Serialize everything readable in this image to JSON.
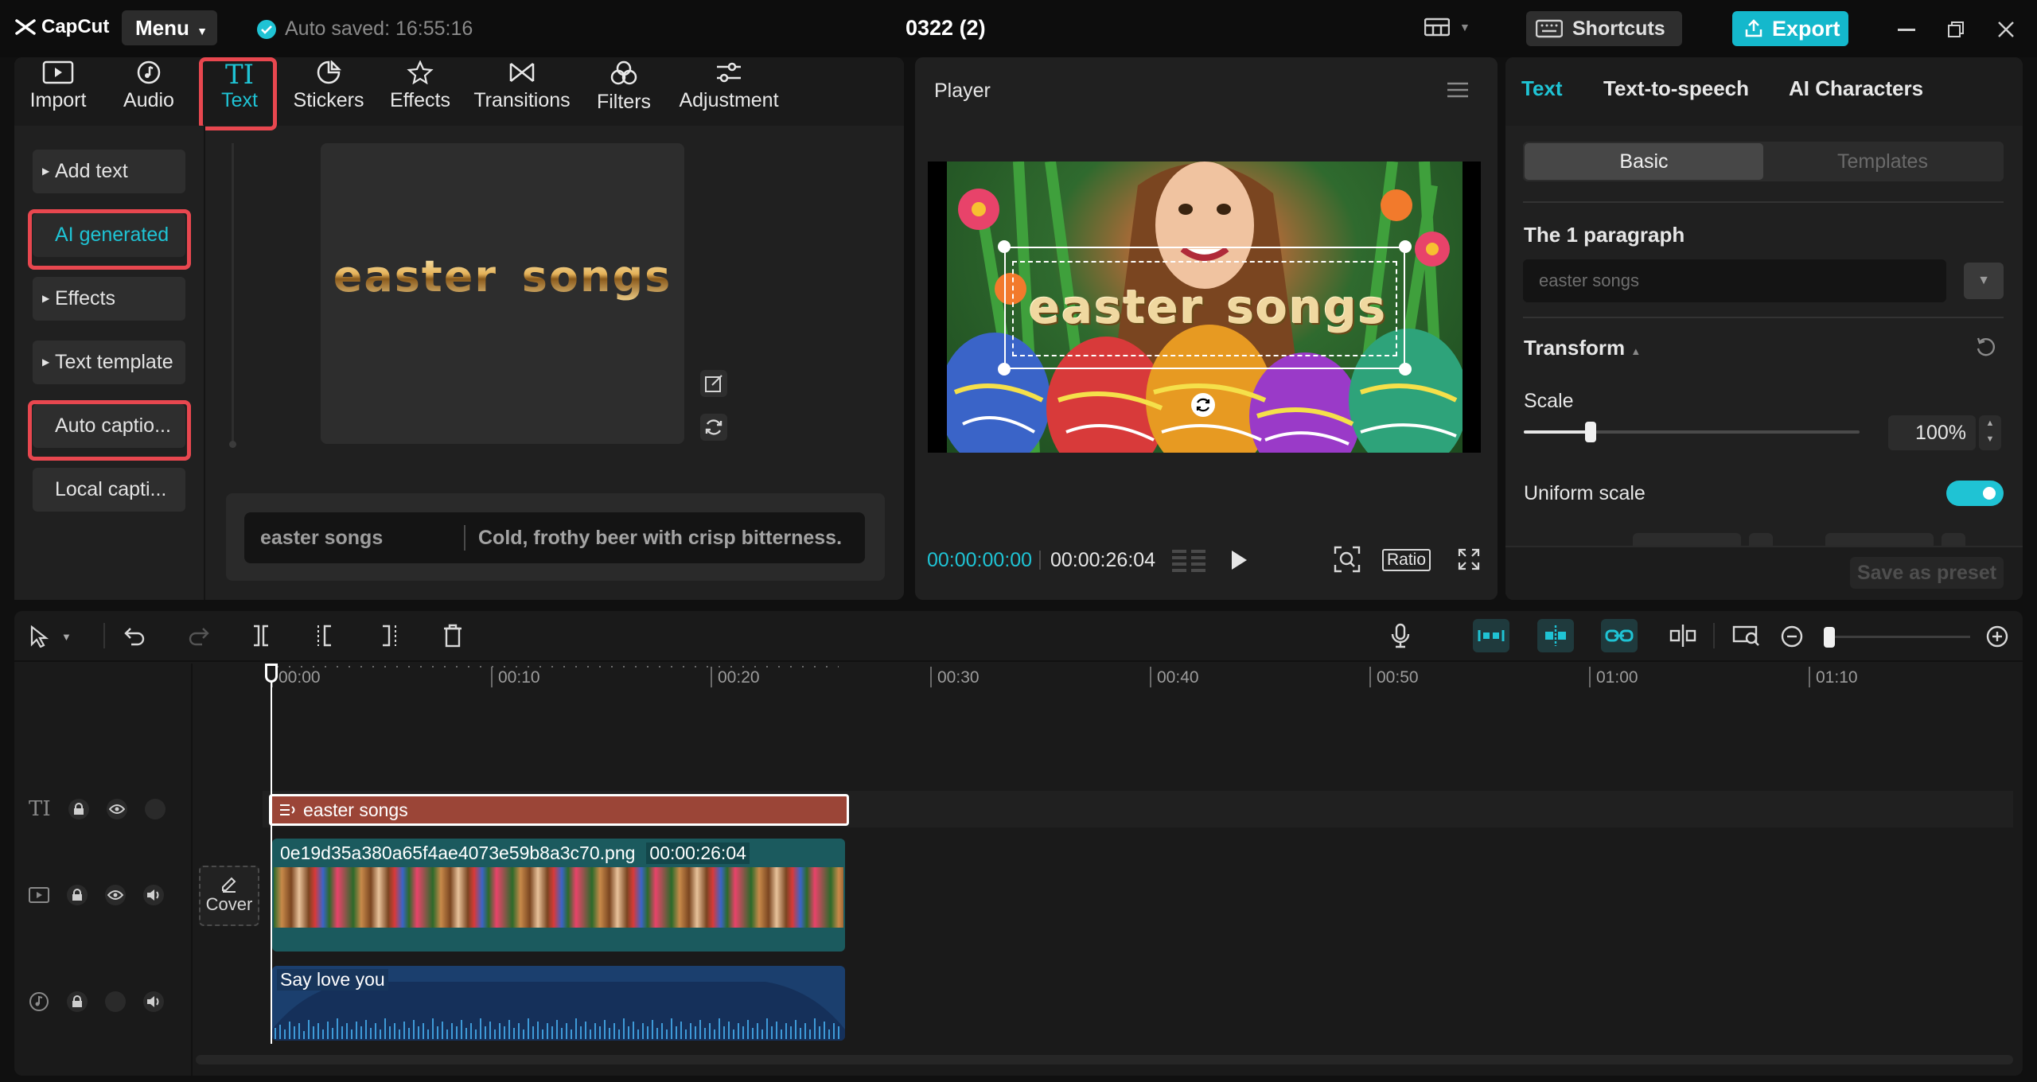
{
  "app": {
    "name": "CapCut",
    "menu_label": "Menu",
    "autosave": "Auto saved: 16:55:16",
    "project_title": "0322 (2)",
    "shortcuts_label": "Shortcuts",
    "export_label": "Export"
  },
  "toolbar": {
    "items": [
      {
        "label": "Import"
      },
      {
        "label": "Audio"
      },
      {
        "label": "Text"
      },
      {
        "label": "Stickers"
      },
      {
        "label": "Effects"
      },
      {
        "label": "Transitions"
      },
      {
        "label": "Filters"
      },
      {
        "label": "Adjustment"
      }
    ]
  },
  "text_sidebar": {
    "items": [
      {
        "label": "Add text"
      },
      {
        "label": "AI generated"
      },
      {
        "label": "Effects"
      },
      {
        "label": "Text template"
      },
      {
        "label": "Auto captio..."
      },
      {
        "label": "Local capti..."
      }
    ]
  },
  "ai_generated": {
    "preview_text": "easter songs",
    "prompt_text": "easter songs",
    "prompt_hint": "Cold, frothy beer with crisp bitterness."
  },
  "player": {
    "title": "Player",
    "overlay_text": "easter songs",
    "time_current": "00:00:00:00",
    "time_total": "00:00:26:04",
    "ratio_label": "Ratio"
  },
  "inspector": {
    "tabs": [
      {
        "label": "Text"
      },
      {
        "label": "Text-to-speech"
      },
      {
        "label": "AI Characters"
      }
    ],
    "subtabs": [
      {
        "label": "Basic"
      },
      {
        "label": "Templates"
      }
    ],
    "paragraph_title": "The 1 paragraph",
    "paragraph_value": "easter songs",
    "transform_label": "Transform",
    "scale_label": "Scale",
    "scale_value": "100%",
    "scale_level": 0.2,
    "uniform_scale_label": "Uniform scale",
    "uniform_scale_on": true,
    "save_preset_label": "Save as preset"
  },
  "timeline": {
    "ruler": [
      "00:00",
      "00:10",
      "00:20",
      "00:30",
      "00:40",
      "00:50",
      "01:00",
      "01:10"
    ],
    "cover_label": "Cover",
    "text_clip": "easter songs",
    "video_clip_name": "0e19d35a380a65f4ae4073e59b8a3c70.png",
    "video_clip_duration": "00:00:26:04",
    "audio_clip": "Say love you"
  },
  "colors": {
    "accent": "#1fc3d4",
    "highlight": "#e8474f",
    "text_clip": "#9b4537",
    "video_clip": "#1b5a5e",
    "audio_clip": "#1b3f6e"
  }
}
